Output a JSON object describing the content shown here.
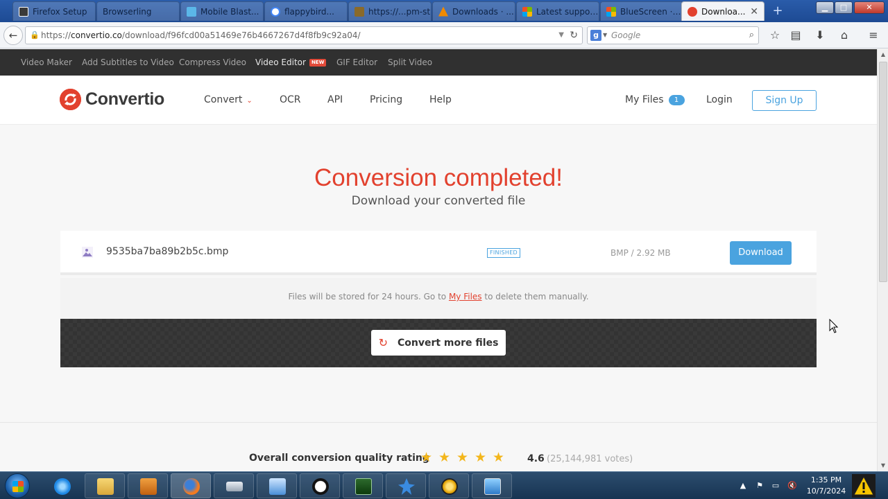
{
  "browser": {
    "tabs": [
      {
        "label": "Firefox Setup",
        "color": "#3a3a3a"
      },
      {
        "label": "Browserling",
        "color": "#7a4fb0"
      },
      {
        "label": "Mobile Blast...",
        "color": "#5bb7e8"
      },
      {
        "label": "flappybird...",
        "color": "#4285f4"
      },
      {
        "label": "https://...pm-st",
        "color": "#8a6a2a"
      },
      {
        "label": "Downloads · ...",
        "color": "#f08a00"
      },
      {
        "label": "Latest suppor...",
        "color": "#f25022"
      },
      {
        "label": "BlueScreen · ...",
        "color": "#00a4ef"
      },
      {
        "label": "Downloa...",
        "color": "#e2412e",
        "active": true
      }
    ],
    "url_host": "convertio.co",
    "url_path": "/download/f96fcd00a51469e76b4667267d4f8fb9c92a04/",
    "url_scheme": "https://",
    "search_placeholder": "Google",
    "search_engine_letter": "g"
  },
  "topbar": {
    "items": [
      "Video Maker",
      "Add Subtitles to Video",
      "Compress Video",
      "Video Editor",
      "GIF Editor",
      "Split Video"
    ],
    "new_badge": "NEW"
  },
  "header": {
    "logo_text": "Convertio",
    "nav": [
      "Convert",
      "OCR",
      "API",
      "Pricing",
      "Help"
    ],
    "my_files": "My Files",
    "my_files_count": "1",
    "login": "Login",
    "signup": "Sign Up"
  },
  "main": {
    "title": "Conversion completed!",
    "subtitle": "Download your converted file",
    "file": {
      "name": "9535ba7ba89b2b5c.bmp",
      "status": "FINISHED",
      "meta": "BMP / 2.92 MB",
      "download_label": "Download"
    },
    "storage_note_before": "Files will be stored for 24 hours. Go to ",
    "storage_note_link": "My Files",
    "storage_note_after": " to delete them manually.",
    "convert_more": "Convert more files"
  },
  "rating": {
    "label": "Overall conversion quality rating",
    "stars": 4.5,
    "value": "4.6",
    "votes": "(25,144,981 votes)"
  },
  "taskbar": {
    "clock_time": "1:35 PM",
    "clock_date": "10/7/2024",
    "apps": [
      "internet-explorer",
      "file-explorer",
      "media-player",
      "firefox",
      "drive",
      "control-panel",
      "panda",
      "task-manager",
      "network-bird",
      "globe",
      "display"
    ]
  },
  "colors": {
    "brand_red": "#e2412e",
    "accent_blue": "#4aa3df",
    "topbar_bg": "#303030"
  }
}
